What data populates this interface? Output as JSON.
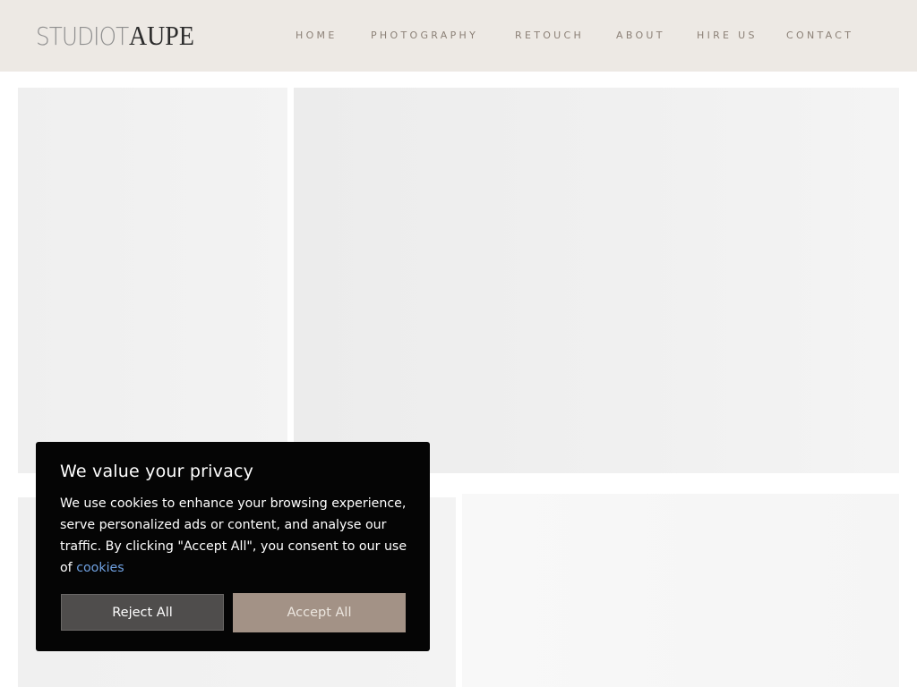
{
  "brand": {
    "logo_part1": "STUDIOT",
    "logo_part2": "AUPE"
  },
  "nav": {
    "items": [
      {
        "label": "HOME"
      },
      {
        "label": "PHOTOGRAPHY"
      },
      {
        "label": "RETOUCH"
      },
      {
        "label": "ABOUT"
      },
      {
        "label": "HIRE US"
      },
      {
        "label": "CONTACT"
      }
    ]
  },
  "cookie_banner": {
    "title": "We value your privacy",
    "body": "We use cookies to enhance your browsing experience, serve personalized ads or content, and analyse our traffic. By clicking \"Accept All\", you consent to our use of ",
    "link_label": "cookies",
    "reject_label": "Reject All",
    "accept_label": "Accept All"
  },
  "colors": {
    "header_bg": "#ede9e4",
    "nav_text": "#8c8177",
    "banner_bg": "#050505",
    "reject_bg": "#4f4d4c",
    "accept_bg": "#a39286",
    "link": "#6fa0e0"
  }
}
